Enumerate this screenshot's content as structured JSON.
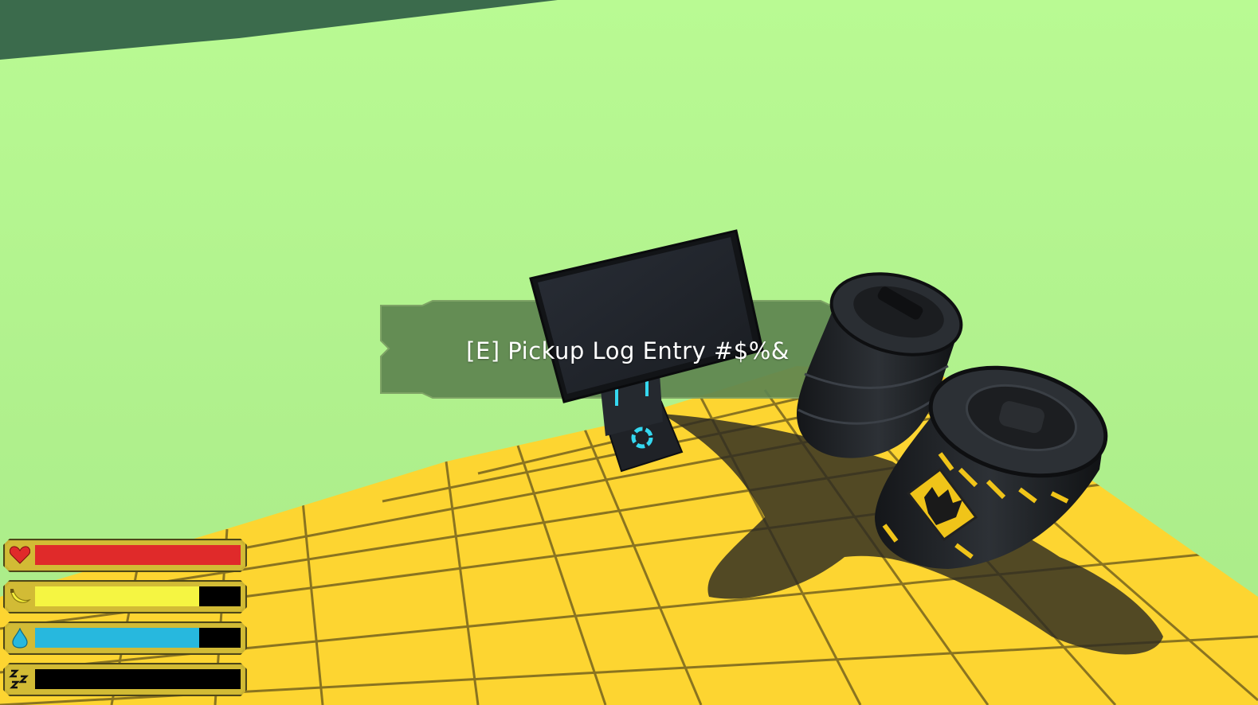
{
  "interaction_prompt": {
    "text": "[E] Pickup Log Entry #$%&"
  },
  "hud": {
    "bars": [
      {
        "id": "health",
        "icon": "heart-icon",
        "fill": 1.0,
        "color": "#e02a2a"
      },
      {
        "id": "hunger",
        "icon": "banana-icon",
        "fill": 0.8,
        "color": "#f5f542"
      },
      {
        "id": "thirst",
        "icon": "water-drop-icon",
        "fill": 0.8,
        "color": "#27b8de"
      },
      {
        "id": "sleep",
        "icon": "sleep-zzz-icon",
        "fill": 0.0,
        "color": "#000000"
      }
    ]
  },
  "colors": {
    "sky": "#b1f58e",
    "floor": "#fdd531",
    "floor_grid": "#8a7420",
    "prompt_panel": "#5e8550"
  }
}
